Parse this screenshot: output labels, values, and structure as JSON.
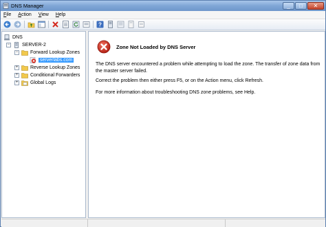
{
  "window": {
    "title": "DNS Manager"
  },
  "caption_buttons": {
    "minimize": "_",
    "maximize": "□",
    "close": "✕"
  },
  "menu": [
    {
      "accel": "F",
      "rest": "ile"
    },
    {
      "accel": "A",
      "rest": "ction"
    },
    {
      "accel": "V",
      "rest": "iew"
    },
    {
      "accel": "H",
      "rest": "elp"
    }
  ],
  "toolbar_icons": [
    "back-arrow-icon",
    "forward-arrow-icon",
    "up-folder-icon",
    "show-hide-tree-icon",
    "delete-icon",
    "properties-icon",
    "refresh-icon",
    "export-icon",
    "help-icon",
    "server-icon",
    "zone-icon",
    "record-icon",
    "new-host-icon"
  ],
  "tree": {
    "root": "DNS",
    "server": "SERVER-2",
    "forward_zones": "Forward Lookup Zones",
    "zone": "serverlabs.com",
    "reverse_zones": "Reverse Lookup Zones",
    "conditional": "Conditional Forwarders",
    "global_logs": "Global Logs",
    "expand_symbol": "+",
    "collapse_symbol": "−"
  },
  "detail": {
    "title": "Zone Not Loaded by DNS Server",
    "paragraph1": "The DNS server encountered a problem while attempting to load the zone. The transfer of zone data from the master server failed.",
    "paragraph2": "Correct the problem then either press F5, or on the Action menu, click Refresh.",
    "paragraph3": "For more information about troubleshooting DNS zone problems, see Help."
  },
  "colors": {
    "selection": "#3399ff",
    "error": "#d42a1f",
    "folder": "#f2c94c"
  }
}
